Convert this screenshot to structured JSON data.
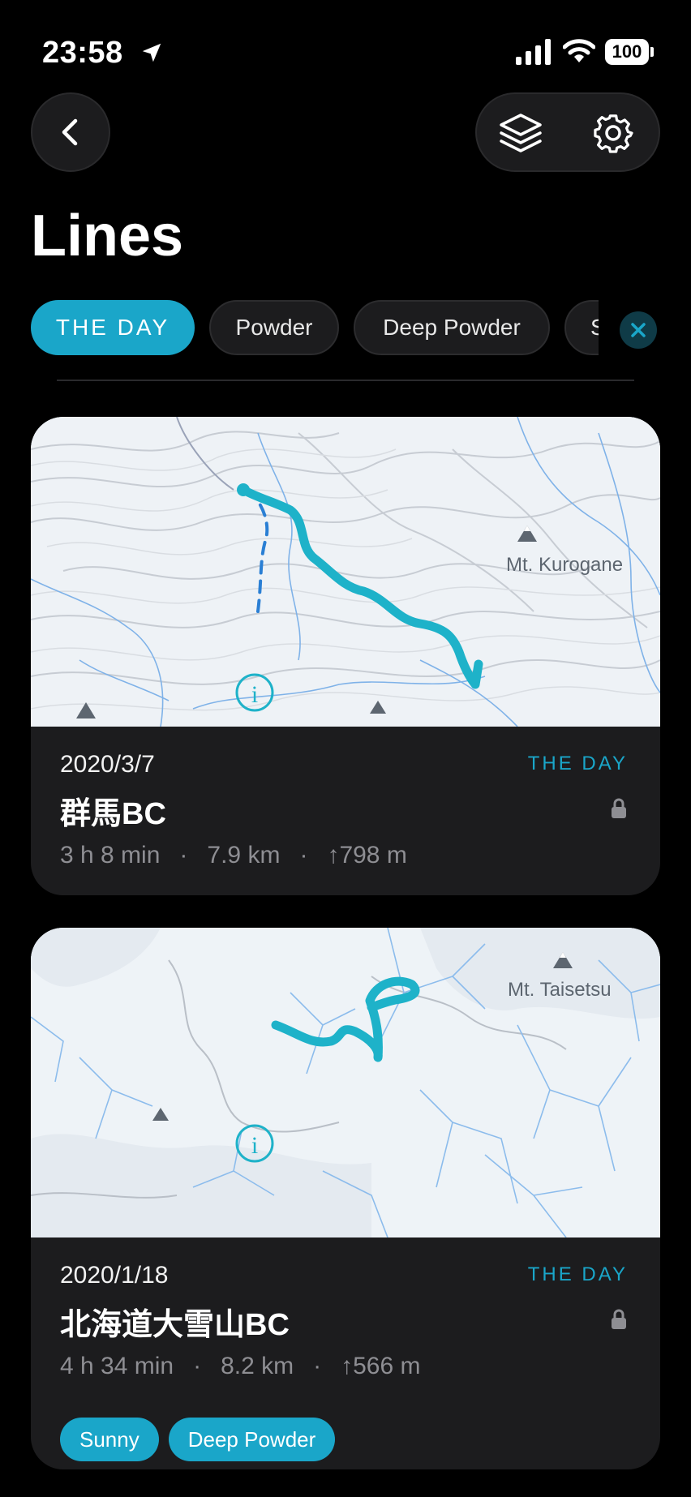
{
  "status": {
    "time": "23:58",
    "battery": "100",
    "icons": [
      "location-arrow-icon",
      "signal-icon",
      "wifi-icon",
      "battery-icon"
    ]
  },
  "header": {
    "back_icon": "chevron-left-icon",
    "layers_icon": "layers-icon",
    "settings_icon": "gear-icon",
    "title": "Lines"
  },
  "filters": {
    "chips": [
      "THE DAY",
      "Powder",
      "Deep Powder",
      "S"
    ],
    "active": "THE DAY",
    "clear_icon": "close-icon"
  },
  "colors": {
    "accent": "#1aa6c9",
    "background": "#000000",
    "card": "#1c1c1e",
    "secondary_text": "#8e8e93"
  },
  "cards": [
    {
      "date": "2020/3/7",
      "tag": "THE DAY",
      "name": "群馬BC",
      "duration": "3 h 8 min",
      "distance": "7.9 km",
      "elevation": "↑798 m",
      "map_label": "Mt. Kurogane",
      "badges": []
    },
    {
      "date": "2020/1/18",
      "tag": "THE DAY",
      "name": "北海道大雪山BC",
      "duration": "4 h 34 min",
      "distance": "8.2 km",
      "elevation": "↑566 m",
      "map_label": "Mt. Taisetsu",
      "badges": [
        "Sunny",
        "Deep Powder"
      ]
    }
  ],
  "separator": "·"
}
